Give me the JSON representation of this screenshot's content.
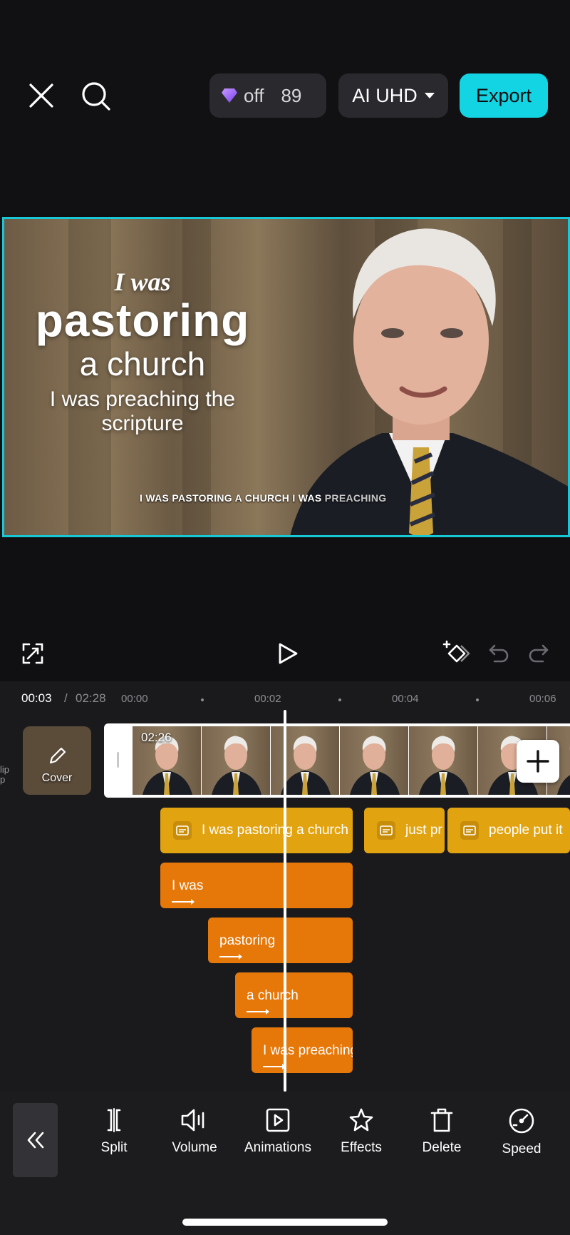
{
  "header": {
    "pro_label": "off",
    "pro_count": "89",
    "quality_label": "AI UHD",
    "export_label": "Export"
  },
  "preview": {
    "title_lines": [
      "I was",
      "pastoring",
      "a church",
      "I was preaching the",
      "scripture"
    ],
    "caption_bright": "I WAS PASTORING A CHURCH I WAS",
    "caption_dim": " PREACHING"
  },
  "timeline": {
    "current_time": "00:03",
    "separator": "/",
    "total_time": "02:28",
    "ruler": [
      "00:00",
      "00:02",
      "00:04",
      "00:06"
    ],
    "side_label": "lip\np",
    "cover_label": "Cover",
    "clip_duration": "02:26",
    "caption_segments": [
      "I was pastoring a church",
      "just pr",
      "people put it"
    ],
    "text_segments": [
      "I was",
      "pastoring",
      "a church",
      "I was preaching"
    ]
  },
  "toolbar": {
    "tools": [
      "Split",
      "Volume",
      "Animations",
      "Effects",
      "Delete",
      "Speed"
    ]
  },
  "colors": {
    "accent": "#12d4e3",
    "caption_track": "#e2a310",
    "text_track": "#e67709",
    "background": "#101012"
  }
}
